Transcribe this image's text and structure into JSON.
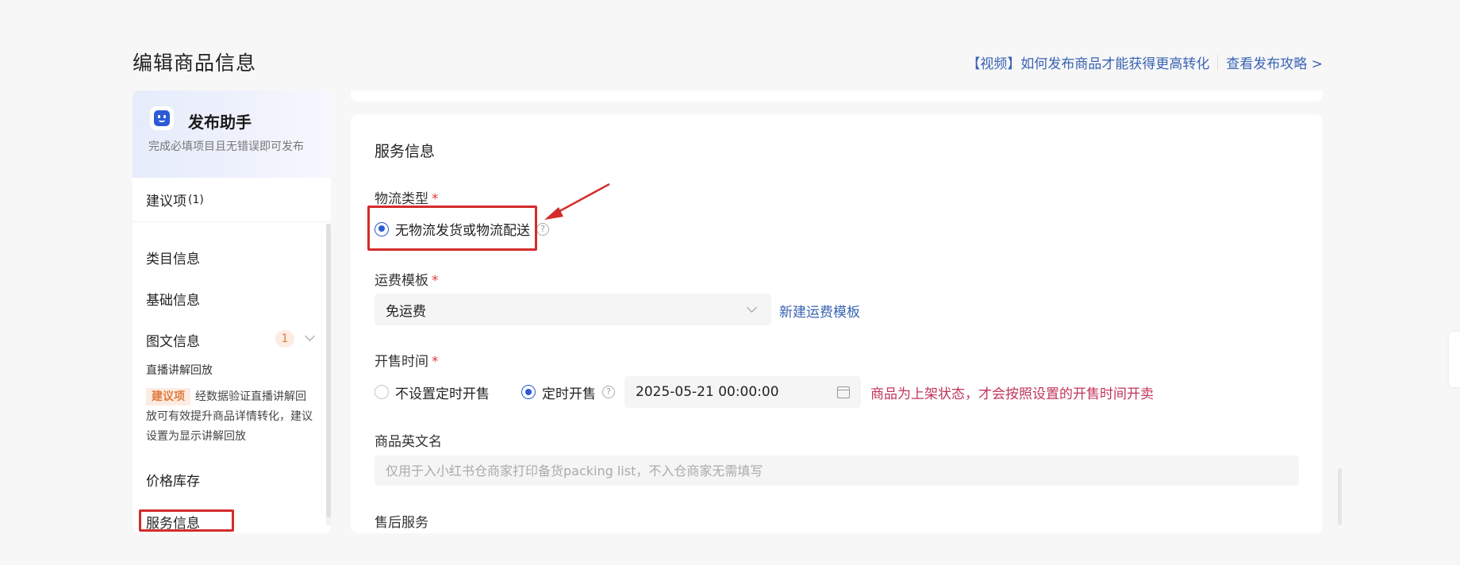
{
  "header": {
    "title": "编辑商品信息",
    "video_link": "【视频】如何发布商品才能获得更高转化",
    "guide_link": "查看发布攻略 >"
  },
  "sidebar": {
    "assistant_title": "发布助手",
    "assistant_subtitle": "完成必填项目且无错误即可发布",
    "suggest_label": "建议项",
    "suggest_count": "(1)",
    "items": [
      {
        "label": "类目信息"
      },
      {
        "label": "基础信息"
      },
      {
        "label": "图文信息",
        "badge": "1"
      },
      {
        "label": "价格库存"
      },
      {
        "label": "服务信息"
      }
    ],
    "sub_title": "直播讲解回放",
    "sub_tag": "建议项",
    "sub_desc": "经数据验证直播讲解回放可有效提升商品详情转化，建议设置为显示讲解回放"
  },
  "main": {
    "section_title": "服务信息",
    "logistics": {
      "label": "物流类型",
      "required": "*",
      "option": "无物流发货或物流配送",
      "help": "?"
    },
    "freight": {
      "label": "运费模板",
      "required": "*",
      "value": "免运费",
      "new_link": "新建运费模板"
    },
    "sale_time": {
      "label": "开售时间",
      "required": "*",
      "option_none": "不设置定时开售",
      "option_timed": "定时开售",
      "help": "?",
      "datetime": "2025-05-21 00:00:00",
      "warning": "商品为上架状态，才会按照设置的开售时间开卖"
    },
    "english_name": {
      "label": "商品英文名",
      "placeholder": "仅用于入小红书仓商家打印备货packing list，不入仓商家无需填写"
    },
    "after_sales": {
      "label": "售后服务"
    }
  },
  "colors": {
    "accent": "#2d5ad6",
    "link": "#3a64b0",
    "annotation_red": "#d32c2c",
    "warning": "#c0355a"
  }
}
